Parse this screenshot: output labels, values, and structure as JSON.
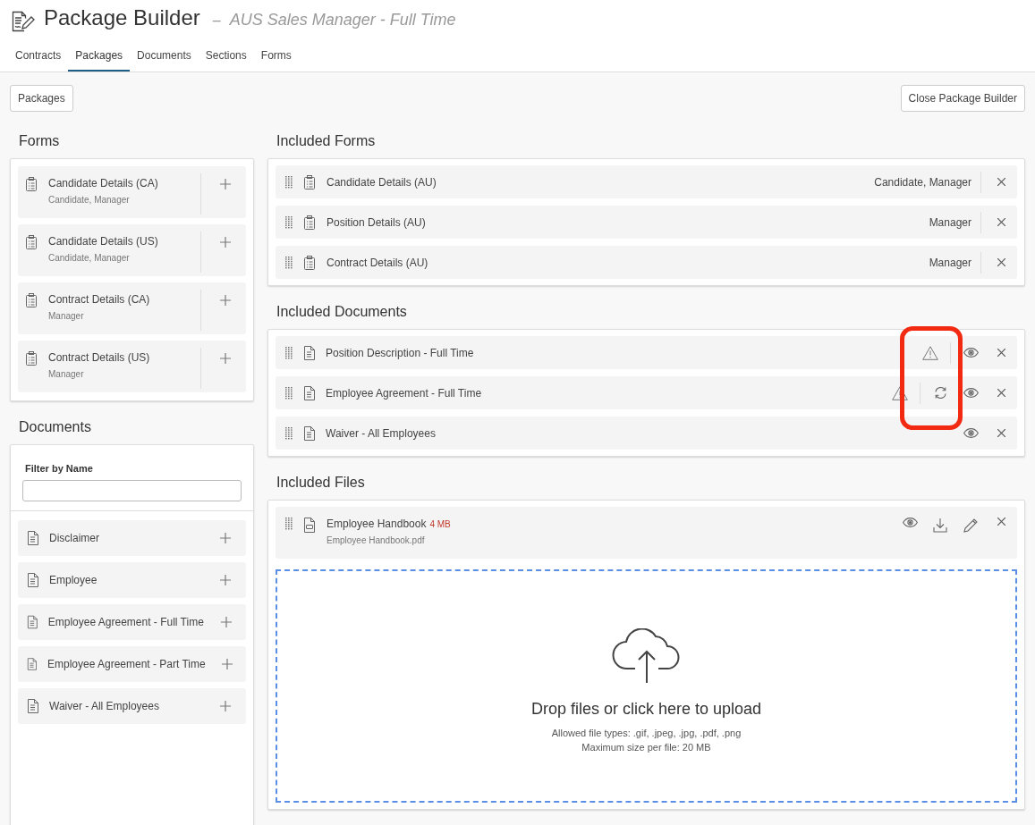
{
  "header": {
    "title": "Package Builder",
    "separator": "–",
    "subtitle": "AUS Sales Manager - Full Time"
  },
  "tabs": [
    {
      "label": "Contracts",
      "selected": false
    },
    {
      "label": "Packages",
      "selected": true
    },
    {
      "label": "Documents",
      "selected": false
    },
    {
      "label": "Sections",
      "selected": false
    },
    {
      "label": "Forms",
      "selected": false
    }
  ],
  "toolbar": {
    "left_button": "Packages",
    "right_button": "Close Package Builder"
  },
  "forms": {
    "heading": "Forms",
    "items": [
      {
        "name": "Candidate Details (CA)",
        "roles": "Candidate, Manager"
      },
      {
        "name": "Candidate Details (US)",
        "roles": "Candidate, Manager"
      },
      {
        "name": "Contract Details (CA)",
        "roles": "Manager"
      },
      {
        "name": "Contract Details (US)",
        "roles": "Manager"
      }
    ]
  },
  "documents": {
    "heading": "Documents",
    "filter_label": "Filter by Name",
    "items": [
      {
        "name": "Disclaimer"
      },
      {
        "name": "Employee"
      },
      {
        "name": "Employee Agreement - Full Time"
      },
      {
        "name": "Employee Agreement - Part Time"
      },
      {
        "name": "Waiver - All Employees"
      }
    ]
  },
  "included_forms": {
    "heading": "Included Forms",
    "items": [
      {
        "name": "Candidate Details (AU)",
        "roles": "Candidate, Manager"
      },
      {
        "name": "Position Details (AU)",
        "roles": "Manager"
      },
      {
        "name": "Contract Details (AU)",
        "roles": "Manager"
      }
    ]
  },
  "included_documents": {
    "heading": "Included Documents",
    "highlighted": true,
    "items": [
      {
        "name": "Position Description - Full Time",
        "warning": true,
        "sync": false
      },
      {
        "name": "Employee Agreement - Full Time",
        "warning": true,
        "sync": true
      },
      {
        "name": "Waiver - All Employees",
        "warning": false,
        "sync": false
      }
    ]
  },
  "included_files": {
    "heading": "Included Files",
    "items": [
      {
        "name": "Employee Handbook",
        "size": "4 MB",
        "filename": "Employee Handbook.pdf"
      }
    ],
    "dropzone": {
      "title": "Drop files or click here to upload",
      "types": "Allowed file types: .gif, .jpeg, .jpg, .pdf, .png",
      "max_size": "Maximum size per file: 20 MB"
    }
  }
}
